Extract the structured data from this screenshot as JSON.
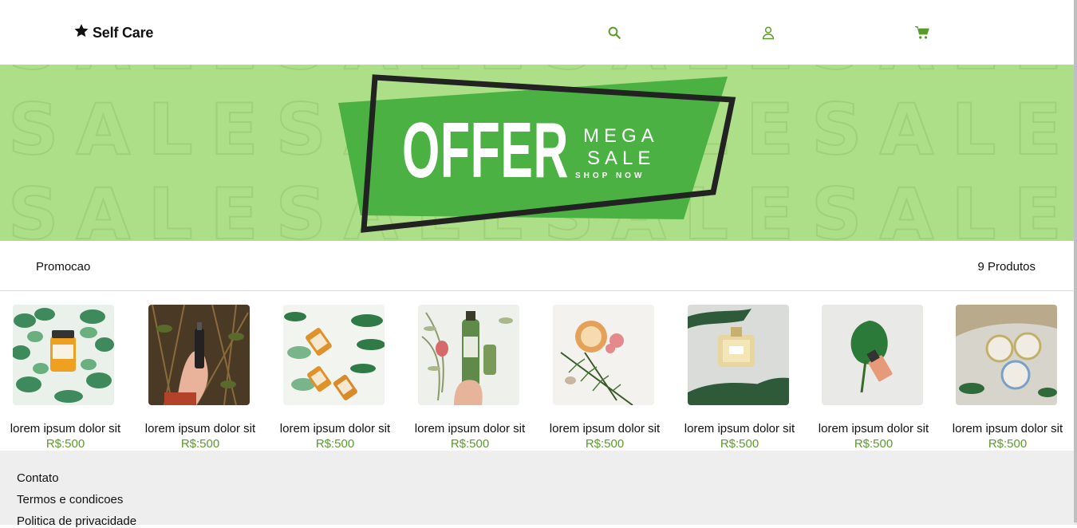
{
  "header": {
    "brand": "Self Care",
    "icons": [
      "star-icon",
      "search-icon",
      "user-icon",
      "cart-icon"
    ]
  },
  "banner": {
    "title": "OFFER",
    "subtitle_line1": "MEGA",
    "subtitle_line2": "SALE",
    "cta": "SHOP NOW",
    "background_word": "SALE",
    "colors": {
      "background": "#addf89",
      "panel": "#4bb143",
      "frame": "#222222"
    }
  },
  "category": {
    "title": "Promocao",
    "count": "9 Produtos"
  },
  "products": [
    {
      "name": "lorem ipsum dolor sit",
      "price": "R$:500"
    },
    {
      "name": "lorem ipsum dolor sit",
      "price": "R$:500"
    },
    {
      "name": "lorem ipsum dolor sit",
      "price": "R$:500"
    },
    {
      "name": "lorem ipsum dolor sit",
      "price": "R$:500"
    },
    {
      "name": "lorem ipsum dolor sit",
      "price": "R$:500"
    },
    {
      "name": "lorem ipsum dolor sit",
      "price": "R$:500"
    },
    {
      "name": "lorem ipsum dolor sit",
      "price": "R$:500"
    },
    {
      "name": "lorem ipsum dolor sit",
      "price": "R$:500"
    }
  ],
  "footer": {
    "links": [
      "Contato",
      "Termos e condicoes",
      "Politica de privacidade"
    ]
  },
  "colors": {
    "accent": "#5a9a2a",
    "footer_bg": "#eeeeee"
  }
}
